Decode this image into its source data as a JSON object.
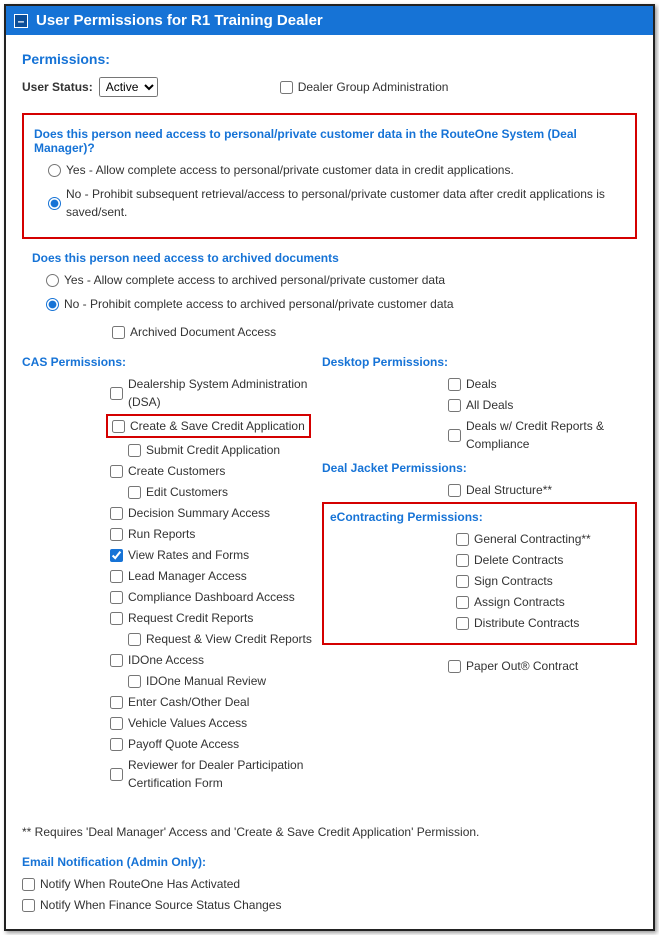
{
  "title": "User Permissions for R1 Training Dealer",
  "sectionTitle": "Permissions:",
  "userStatusLabel": "User Status:",
  "userStatusValue": "Active",
  "dealerGroupAdmin": "Dealer Group Administration",
  "q1": {
    "title": "Does this person need access to personal/private customer data in the RouteOne System (Deal Manager)?",
    "yes": "Yes - Allow complete access to personal/private customer data in credit applications.",
    "no": "No - Prohibit subsequent retrieval/access to personal/private customer data after credit applications is saved/sent."
  },
  "q2": {
    "title": "Does this person need access to archived documents",
    "yes": "Yes - Allow complete access to archived personal/private customer data",
    "no": "No - Prohibit complete access to archived personal/private customer data",
    "archAccess": "Archived Document Access"
  },
  "cas": {
    "title": "CAS Permissions:",
    "items": {
      "dsa": "Dealership System Administration (DSA)",
      "createSave": "Create & Save Credit Application",
      "submit": "Submit Credit Application",
      "createCust": "Create Customers",
      "editCust": "Edit Customers",
      "decSummary": "Decision Summary Access",
      "runReports": "Run Reports",
      "viewRates": "View Rates and Forms",
      "leadMgr": "Lead Manager Access",
      "compDash": "Compliance Dashboard Access",
      "reqCredit": "Request Credit Reports",
      "reqView": "Request & View Credit Reports",
      "idone": "IDOne Access",
      "idoneManual": "IDOne Manual Review",
      "enterCash": "Enter Cash/Other Deal",
      "vehVals": "Vehicle Values Access",
      "payoff": "Payoff Quote Access",
      "reviewer": "Reviewer for Dealer Participation Certification Form"
    }
  },
  "desktop": {
    "title": "Desktop Permissions:",
    "deals": "Deals",
    "allDeals": "All Deals",
    "dealsCompliance": "Deals w/ Credit Reports & Compliance"
  },
  "dealJacket": {
    "title": "Deal Jacket Permissions:",
    "structure": "Deal Structure**"
  },
  "econ": {
    "title": "eContracting Permissions:",
    "general": "General Contracting**",
    "delete": "Delete Contracts",
    "sign": "Sign Contracts",
    "assign": "Assign Contracts",
    "distribute": "Distribute Contracts",
    "paperout": "Paper Out® Contract"
  },
  "footnote": "** Requires 'Deal Manager' Access and 'Create & Save Credit Application' Permission.",
  "email": {
    "title": "Email Notification (Admin Only):",
    "notify1": "Notify When RouteOne Has Activated",
    "notify2": "Notify When Finance Source Status Changes"
  }
}
